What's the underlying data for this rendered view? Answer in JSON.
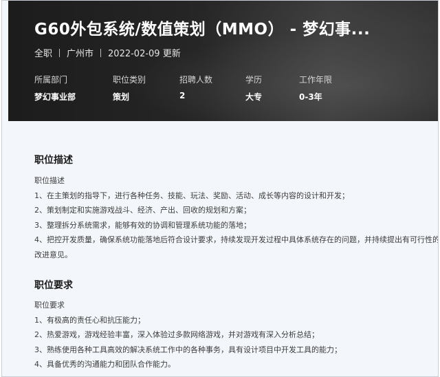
{
  "header": {
    "title": "G60外包系统/数值策划（MMO） - 梦幻事...",
    "meta": {
      "type": "全职",
      "city": "广州市",
      "updated": "2022-02-09 更新"
    },
    "info": [
      {
        "label": "所属部门",
        "value": "梦幻事业部"
      },
      {
        "label": "职位类别",
        "value": "策划"
      },
      {
        "label": "招聘人数",
        "value": "2"
      },
      {
        "label": "学历",
        "value": "大专"
      },
      {
        "label": "工作年限",
        "value": "0-3年"
      }
    ]
  },
  "description": {
    "heading": "职位描述",
    "subheading": "职位描述",
    "lines": [
      "1、在主策划的指导下，进行各种任务、技能、玩法、奖励、活动、成长等内容的设计和开发；",
      "2、策划制定和实施游戏战斗、经济、产出、回收的规划和方案；",
      "3、整理拆分系统需求，能够有效的协调和管理系统功能的落地；",
      "4、把控开发质量，确保系统功能落地后符合设计要求，持续发现开发过程中具体系统存在的问题，并持续提出有可行性的",
      "改进意见。"
    ]
  },
  "requirements": {
    "heading": "职位要求",
    "subheading": "职位要求",
    "lines": [
      "1、有极高的责任心和抗压能力；",
      "2、热爱游戏，游戏经验丰富，深入体验过多款网络游戏，并对游戏有深入分析总结；",
      "3、熟练使用各种工具高效的解决系统工作中的各种事务，具有设计项目中开发工具的能力；",
      "4、具备优秀的沟通能力和团队合作能力。"
    ]
  }
}
